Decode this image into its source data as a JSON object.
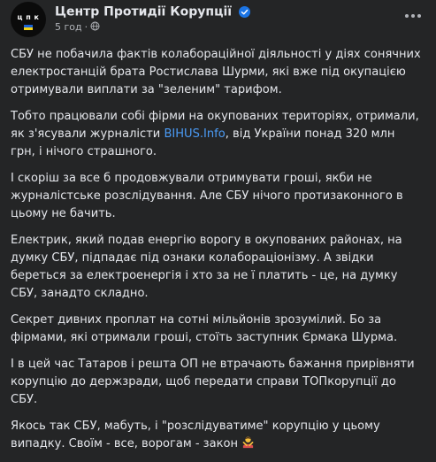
{
  "post": {
    "author": {
      "name": "Центр Протидії Корупції",
      "avatar_text": "ц п к",
      "verified_icon": "verified-badge-icon"
    },
    "meta": {
      "time": "5 год",
      "separator": "·",
      "audience_icon": "globe-icon"
    },
    "more_icon": "more-options-icon",
    "paragraphs": [
      {
        "text": "СБУ не побачила фактів колабораційної діяльності у діях сонячних електростанцій брата Ростислава Шурми, які вже під окупацією отримували виплати за \"зеленим\" тарифом."
      },
      {
        "before": "Тобто працювали собі фірми на окупованих територіях, отримали, як з'ясували журналісти ",
        "link": "BIHUS.Info",
        "after": ", від України понад 320 млн грн, і нічого страшного."
      },
      {
        "text": "І скоріш за все б продовжували отримувати гроші, якби не журналістське розслідування. Але СБУ нічого протизаконного в цьому не бачить."
      },
      {
        "text": "Електрик, який подав енергію ворогу в окупованих районах, на думку СБУ, підпадає під ознаки колабораціонізму. А звідки береться за електроенергія і хто за не ї платить - це, на думку СБУ, занадто складно."
      },
      {
        "text": "Секрет дивних проплат на сотні мільйонів зрозумілий. Бо за фірмами, які отримали гроші, стоїть заступник Єрмака Шурма."
      },
      {
        "text": "І в цей час Татаров і решта ОП не втрачають бажання прирівняти корупцію до держзради, щоб передати справи ТОПкорупції до СБУ."
      },
      {
        "before": "Якось так СБУ, мабуть, і \"розслідуватиме\" корупцію у цьому випадку. Своїм - все, ворогам - закон",
        "emoji_icon": "person-gesturing-no-emoji-icon"
      }
    ],
    "colors": {
      "background": "#242526",
      "text": "#e4e6eb",
      "secondary_text": "#b0b3b8",
      "link": "#4b9bf5",
      "verified": "#1b74e4"
    }
  }
}
